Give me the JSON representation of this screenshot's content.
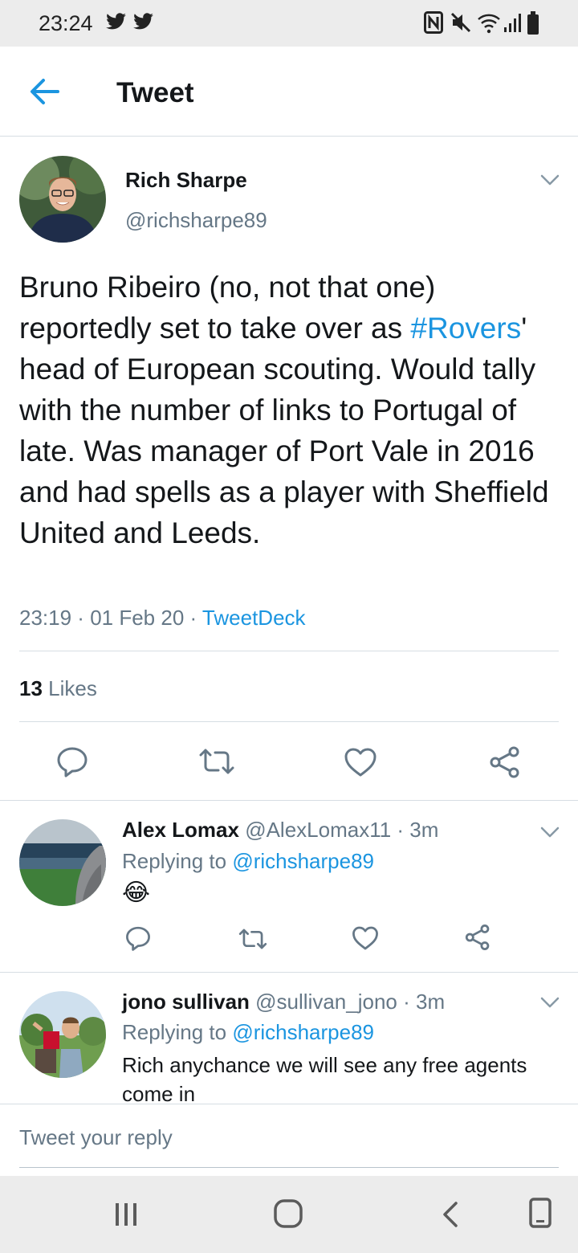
{
  "status_bar": {
    "time": "23:24",
    "left_icons": [
      "twitter-bird-icon",
      "twitter-bird-icon"
    ],
    "right_icons": [
      "nfc-icon",
      "mute-icon",
      "wifi-icon",
      "signal-icon",
      "battery-icon"
    ]
  },
  "header": {
    "title": "Tweet",
    "back_icon": "back-arrow-icon"
  },
  "tweet": {
    "author_name": "Rich Sharpe",
    "author_handle": "@richsharpe89",
    "text_before_hashtag": "Bruno Ribeiro (no, not that one) reportedly set to take over as ",
    "hashtag": "#Rovers",
    "text_after_hashtag": "' head of European scouting. Would tally with the number of links to Portugal of late. Was manager of Port Vale in 2016 and had spells as a player with Sheffield United and Leeds.",
    "time": "23:19",
    "date": "01 Feb 20",
    "source": "TweetDeck",
    "separator": " · ",
    "likes_count": "13",
    "likes_label": "Likes",
    "actions": [
      "reply-icon",
      "retweet-icon",
      "like-icon",
      "share-icon"
    ]
  },
  "replies": [
    {
      "name": "Alex Lomax",
      "handle": "@AlexLomax11",
      "time": "3m",
      "replying_prefix": "Replying to ",
      "replying_to": "@richsharpe89",
      "text": "😂"
    },
    {
      "name": "jono sullivan",
      "handle": "@sullivan_jono",
      "time": "3m",
      "replying_prefix": "Replying to ",
      "replying_to": "@richsharpe89",
      "text": "Rich anychance we will see any free agents come in"
    }
  ],
  "compose": {
    "placeholder": "Tweet your reply"
  },
  "navbar": {
    "buttons": [
      "recent-apps-icon",
      "home-icon",
      "back-icon",
      "screen-rotate-icon"
    ]
  },
  "colors": {
    "accent": "#1b95e0",
    "secondary_text": "#657786",
    "divider": "#d6dde3",
    "system_bar": "#ececec"
  }
}
